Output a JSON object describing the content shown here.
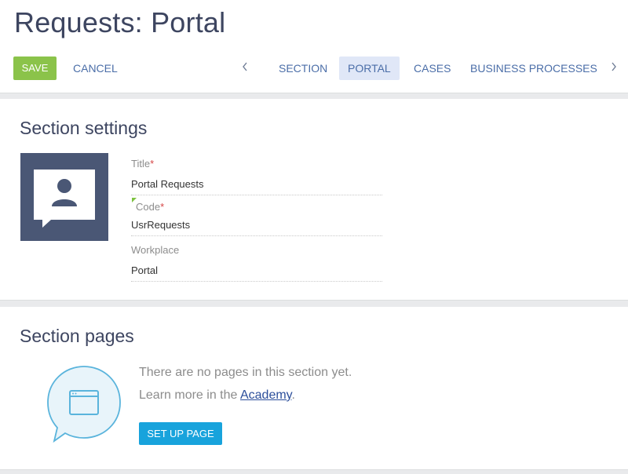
{
  "header": {
    "title": "Requests: Portal",
    "save_label": "SAVE",
    "cancel_label": "CANCEL",
    "tabs": [
      {
        "label": "SECTION",
        "active": false
      },
      {
        "label": "PORTAL",
        "active": true
      },
      {
        "label": "CASES",
        "active": false
      },
      {
        "label": "BUSINESS PROCESSES",
        "active": false
      }
    ],
    "prev_icon": "chevron-left-icon",
    "next_icon": "chevron-right-icon"
  },
  "section_settings": {
    "title": "Section settings",
    "image_icon": "portal-user-icon",
    "fields": [
      {
        "label": "Title",
        "required": true,
        "value": "Portal Requests"
      },
      {
        "label": "Code",
        "required": true,
        "value": "UsrRequests"
      },
      {
        "label": "Workplace",
        "required": false,
        "value": "Portal"
      }
    ]
  },
  "section_pages": {
    "title": "Section pages",
    "empty_message": "There are no pages in this section yet.",
    "learn_more_prefix": "Learn more in the ",
    "academy_link": "Academy",
    "learn_more_suffix": ".",
    "setup_button": "SET UP PAGE",
    "illustration_icon": "chat-bubble-window-icon"
  },
  "colors": {
    "save": "#8bc34a",
    "link": "#4b6ea8",
    "active_tab_bg": "#e0e7f7",
    "image_bg": "#4a5775",
    "setup_button": "#18a3dc",
    "required": "#d64545"
  }
}
